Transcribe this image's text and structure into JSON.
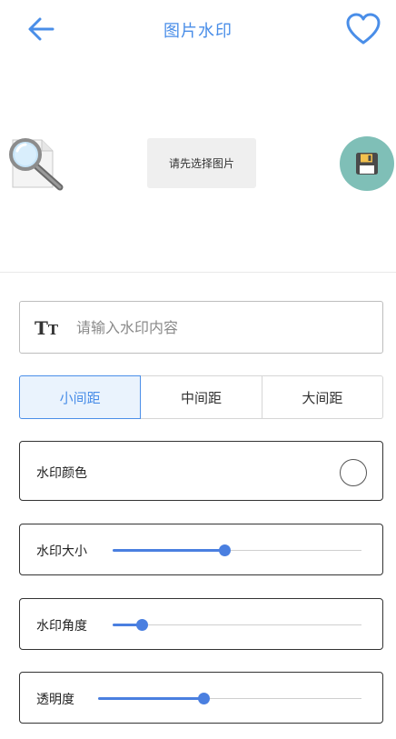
{
  "header": {
    "title": "图片水印",
    "back_icon": "arrow-left-icon",
    "favorite_icon": "heart-outline-icon",
    "accent_color": "#4a8ee8"
  },
  "image_area": {
    "placeholder_icon": "magnifier-document-icon",
    "select_button_label": "请先选择图片",
    "save_icon": "floppy-disk-icon",
    "save_button_color": "#7fbfb7"
  },
  "watermark_text": {
    "icon": "text-size-icon",
    "icon_text_big": "T",
    "icon_text_small": "T",
    "placeholder": "请输入水印内容",
    "value": ""
  },
  "spacing": {
    "options": [
      "小间距",
      "中间距",
      "大间距"
    ],
    "selected": "小间距"
  },
  "color": {
    "label": "水印颜色",
    "value": "#ffffff"
  },
  "size": {
    "label": "水印大小",
    "value": 0.45
  },
  "angle": {
    "label": "水印角度",
    "value": 0.12
  },
  "opacity": {
    "label": "透明度",
    "value": 0.4
  }
}
